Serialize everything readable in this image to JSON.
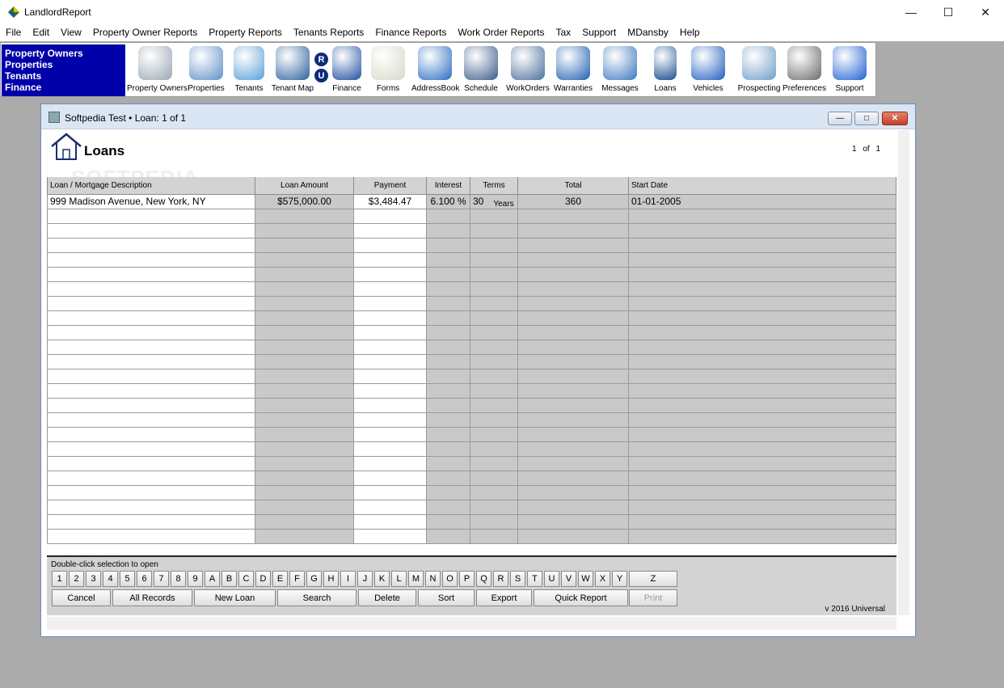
{
  "app": {
    "title": "LandlordReport"
  },
  "menu": [
    "File",
    "Edit",
    "View",
    "Property Owner Reports",
    "Property Reports",
    "Tenants Reports",
    "Finance Reports",
    "Work Order Reports",
    "Tax",
    "Support",
    "MDansby",
    "Help"
  ],
  "side_nav": [
    "Property Owners",
    "Properties",
    "Tenants",
    "Finance"
  ],
  "tools": [
    {
      "label": "Property Owners",
      "icon": "office-building-icon"
    },
    {
      "label": "Properties",
      "icon": "house-icon"
    },
    {
      "label": "Tenants",
      "icon": "people-icon"
    },
    {
      "label": "Tenant Map",
      "icon": "magnifier-icon"
    },
    {
      "label": "Finance",
      "icon": "bank-icon"
    },
    {
      "label": "Forms",
      "icon": "forms-icon"
    },
    {
      "label": "AddressBook",
      "icon": "address-book-icon"
    },
    {
      "label": "Schedule",
      "icon": "notebook-icon"
    },
    {
      "label": "WorkOrders",
      "icon": "tools-icon"
    },
    {
      "label": "Warranties",
      "icon": "warranty-badge-icon"
    },
    {
      "label": "Messages",
      "icon": "telephone-icon"
    },
    {
      "label": "Loans",
      "icon": "hourglass-icon"
    },
    {
      "label": "Vehicles",
      "icon": "car-icon"
    },
    {
      "label": "Prospecting",
      "icon": "skyscraper-icon"
    },
    {
      "label": "Preferences",
      "icon": "wrench-screwdriver-icon"
    },
    {
      "label": "Support",
      "icon": "question-icon"
    }
  ],
  "ru_badges": [
    "R",
    "U"
  ],
  "window": {
    "title": "Softpedia Test  •  Loan: 1 of 1"
  },
  "report": {
    "title": "Loans",
    "page": "1",
    "of": "of",
    "pages": "1",
    "watermark": "SOFTPEDIA"
  },
  "table": {
    "headers": [
      "Loan / Mortgage Description",
      "Loan Amount",
      "Payment",
      "Interest",
      "Terms",
      "Total",
      "Start Date"
    ],
    "rows": [
      {
        "description": "999 Madison Avenue, New York, NY",
        "amount": "$575,000.00",
        "payment": "$3,484.47",
        "interest": "6.100 %",
        "terms": "30",
        "terms_unit": "Years",
        "total": "360",
        "start": "01-01-2005"
      }
    ]
  },
  "bottom": {
    "hint": "Double-click selection to open",
    "keys": [
      "1",
      "2",
      "3",
      "4",
      "5",
      "6",
      "7",
      "8",
      "9",
      "A",
      "B",
      "C",
      "D",
      "E",
      "F",
      "G",
      "H",
      "I",
      "J",
      "K",
      "L",
      "M",
      "N",
      "O",
      "P",
      "Q",
      "R",
      "S",
      "T",
      "U",
      "V",
      "W",
      "X",
      "Y",
      "Z"
    ],
    "actions": [
      "Cancel",
      "All Records",
      "New Loan",
      "Search",
      "Delete",
      "Sort",
      "Export",
      "Quick Report",
      "Print"
    ],
    "version": "v 2016 Universal"
  },
  "colors": {
    "side_nav_bg": "#0000a8",
    "grid_gray": "#c9c9c9",
    "close_red": "#c2402a"
  }
}
